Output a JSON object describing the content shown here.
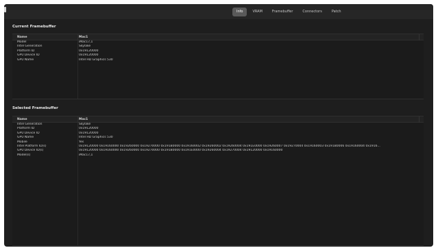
{
  "tabs": [
    {
      "label": "Info",
      "active": true
    },
    {
      "label": "VRAM",
      "active": false
    },
    {
      "label": "Framebuffer",
      "active": false
    },
    {
      "label": "Connectors",
      "active": false
    },
    {
      "label": "Patch",
      "active": false
    }
  ],
  "current_framebuffer": {
    "title": "Current Framebuffer",
    "columns": [
      "Name",
      "Mac1"
    ],
    "rows": [
      {
        "name": "Model",
        "value": "iMac17,1"
      },
      {
        "name": "Intel Generation",
        "value": "Skylake"
      },
      {
        "name": "Platform ID",
        "value": "0x19120000"
      },
      {
        "name": "GPU Device ID",
        "value": "0x19120000"
      },
      {
        "name": "GPU Name",
        "value": "Intel HD Graphics 530"
      }
    ]
  },
  "selected_framebuffer": {
    "title": "Selected Framebuffer",
    "columns": [
      "Name",
      "Mac1"
    ],
    "rows": [
      {
        "name": "Intel Generation",
        "value": "Skylake"
      },
      {
        "name": "Platform ID",
        "value": "0x19120000"
      },
      {
        "name": "GPU Device ID",
        "value": "0x19120000"
      },
      {
        "name": "GPU Name",
        "value": "Intel HD Graphics 530"
      },
      {
        "name": "Mobile",
        "value": "Yes"
      },
      {
        "name": "Intel Platform ID(s)",
        "value": "0x19120000 0x19160000 0x19260000 0x19270000 0x191B0000 0x19160002 0x19260002 0x19260004 0x191E0000 0x19260007 0x19270004 0x19160003 0x191B0006 0x19160004 0x1916..."
      },
      {
        "name": "GPU Device ID(s)",
        "value": "0x19120000 0x19160000 0x19260000 0x19270000 0x191B0000 0x191E0000 0x19260004 0x19270004 0x19120000 0x19160000"
      },
      {
        "name": "Model(s)",
        "value": "iMac17,1"
      }
    ]
  }
}
